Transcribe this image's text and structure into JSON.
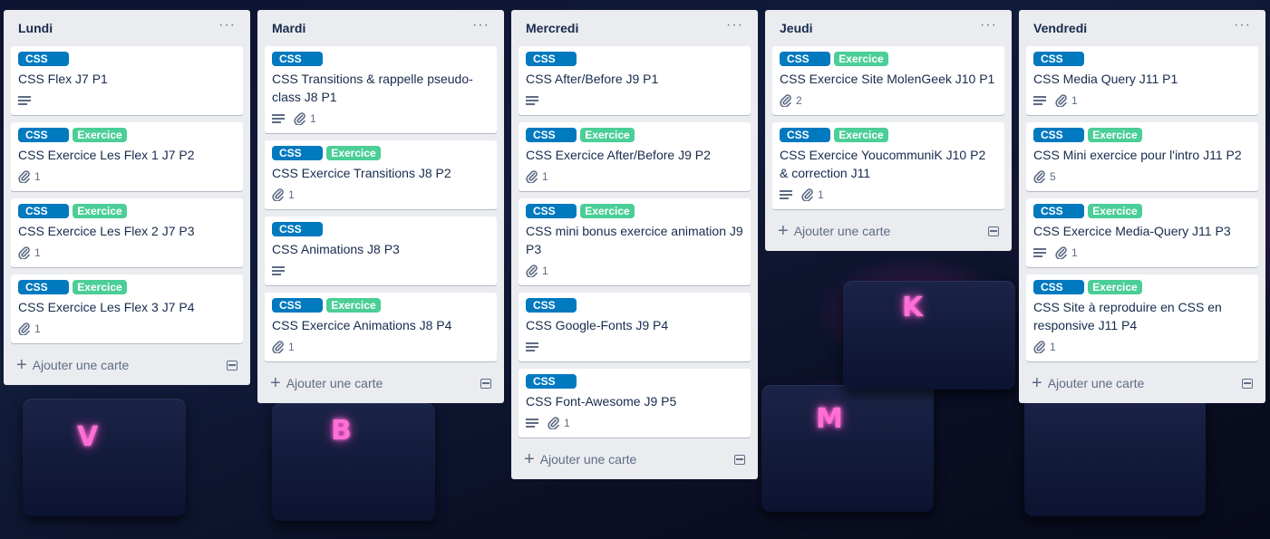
{
  "background": {
    "keys": [
      "V",
      "B",
      "M",
      "K"
    ]
  },
  "lists": [
    {
      "title": "Lundi",
      "add_label": "Ajouter une carte",
      "cards": [
        {
          "labels": [
            "CSS"
          ],
          "title": "CSS Flex J7 P1",
          "description": true,
          "attachments": null
        },
        {
          "labels": [
            "CSS",
            "Exercice"
          ],
          "title": "CSS Exercice Les Flex 1 J7 P2",
          "description": false,
          "attachments": "1"
        },
        {
          "labels": [
            "CSS",
            "Exercice"
          ],
          "title": "CSS Exercice Les Flex 2 J7 P3",
          "description": false,
          "attachments": "1"
        },
        {
          "labels": [
            "CSS",
            "Exercice"
          ],
          "title": "CSS Exercice Les Flex 3 J7 P4",
          "description": false,
          "attachments": "1"
        }
      ]
    },
    {
      "title": "Mardi",
      "add_label": "Ajouter une carte",
      "cards": [
        {
          "labels": [
            "CSS"
          ],
          "title": "CSS Transitions & rappelle pseudo-class J8 P1",
          "description": true,
          "attachments": "1"
        },
        {
          "labels": [
            "CSS",
            "Exercice"
          ],
          "title": "CSS Exercice Transitions J8 P2",
          "description": false,
          "attachments": "1"
        },
        {
          "labels": [
            "CSS"
          ],
          "title": "CSS Animations J8 P3",
          "description": true,
          "attachments": null
        },
        {
          "labels": [
            "CSS",
            "Exercice"
          ],
          "title": "CSS Exercice Animations J8 P4",
          "description": false,
          "attachments": "1"
        }
      ]
    },
    {
      "title": "Mercredi",
      "add_label": "Ajouter une carte",
      "cards": [
        {
          "labels": [
            "CSS"
          ],
          "title": "CSS After/Before J9 P1",
          "description": true,
          "attachments": null
        },
        {
          "labels": [
            "CSS",
            "Exercice"
          ],
          "title": "CSS Exercice After/Before J9 P2",
          "description": false,
          "attachments": "1"
        },
        {
          "labels": [
            "CSS",
            "Exercice"
          ],
          "title": "CSS mini bonus exercice animation J9 P3",
          "description": false,
          "attachments": "1"
        },
        {
          "labels": [
            "CSS"
          ],
          "title": "CSS Google-Fonts J9 P4",
          "description": true,
          "attachments": null
        },
        {
          "labels": [
            "CSS"
          ],
          "title": "CSS Font-Awesome J9 P5",
          "description": true,
          "attachments": "1"
        }
      ]
    },
    {
      "title": "Jeudi",
      "add_label": "Ajouter une carte",
      "cards": [
        {
          "labels": [
            "CSS",
            "Exercice"
          ],
          "title": "CSS Exercice Site MolenGeek J10 P1",
          "description": false,
          "attachments": "2"
        },
        {
          "labels": [
            "CSS",
            "Exercice"
          ],
          "title": "CSS Exercice YoucommuniK J10 P2 & correction J11",
          "description": true,
          "attachments": "1"
        }
      ]
    },
    {
      "title": "Vendredi",
      "add_label": "Ajouter une carte",
      "cards": [
        {
          "labels": [
            "CSS"
          ],
          "title": "CSS Media Query J11 P1",
          "description": true,
          "attachments": "1"
        },
        {
          "labels": [
            "CSS",
            "Exercice"
          ],
          "title": "CSS Mini exercice pour l'intro J11 P2",
          "description": false,
          "attachments": "5"
        },
        {
          "labels": [
            "CSS",
            "Exercice"
          ],
          "title": "CSS Exercice Media-Query J11 P3",
          "description": true,
          "attachments": "1"
        },
        {
          "labels": [
            "CSS",
            "Exercice"
          ],
          "title": "CSS Site à reproduire en CSS en responsive J11 P4",
          "description": false,
          "attachments": "1"
        }
      ]
    }
  ],
  "list_menu_glyph": "···",
  "add_glyph": "+",
  "colors": {
    "label_css": "#0079bf",
    "label_exercice": "#4bce97",
    "list_bg": "#ebecf0"
  }
}
